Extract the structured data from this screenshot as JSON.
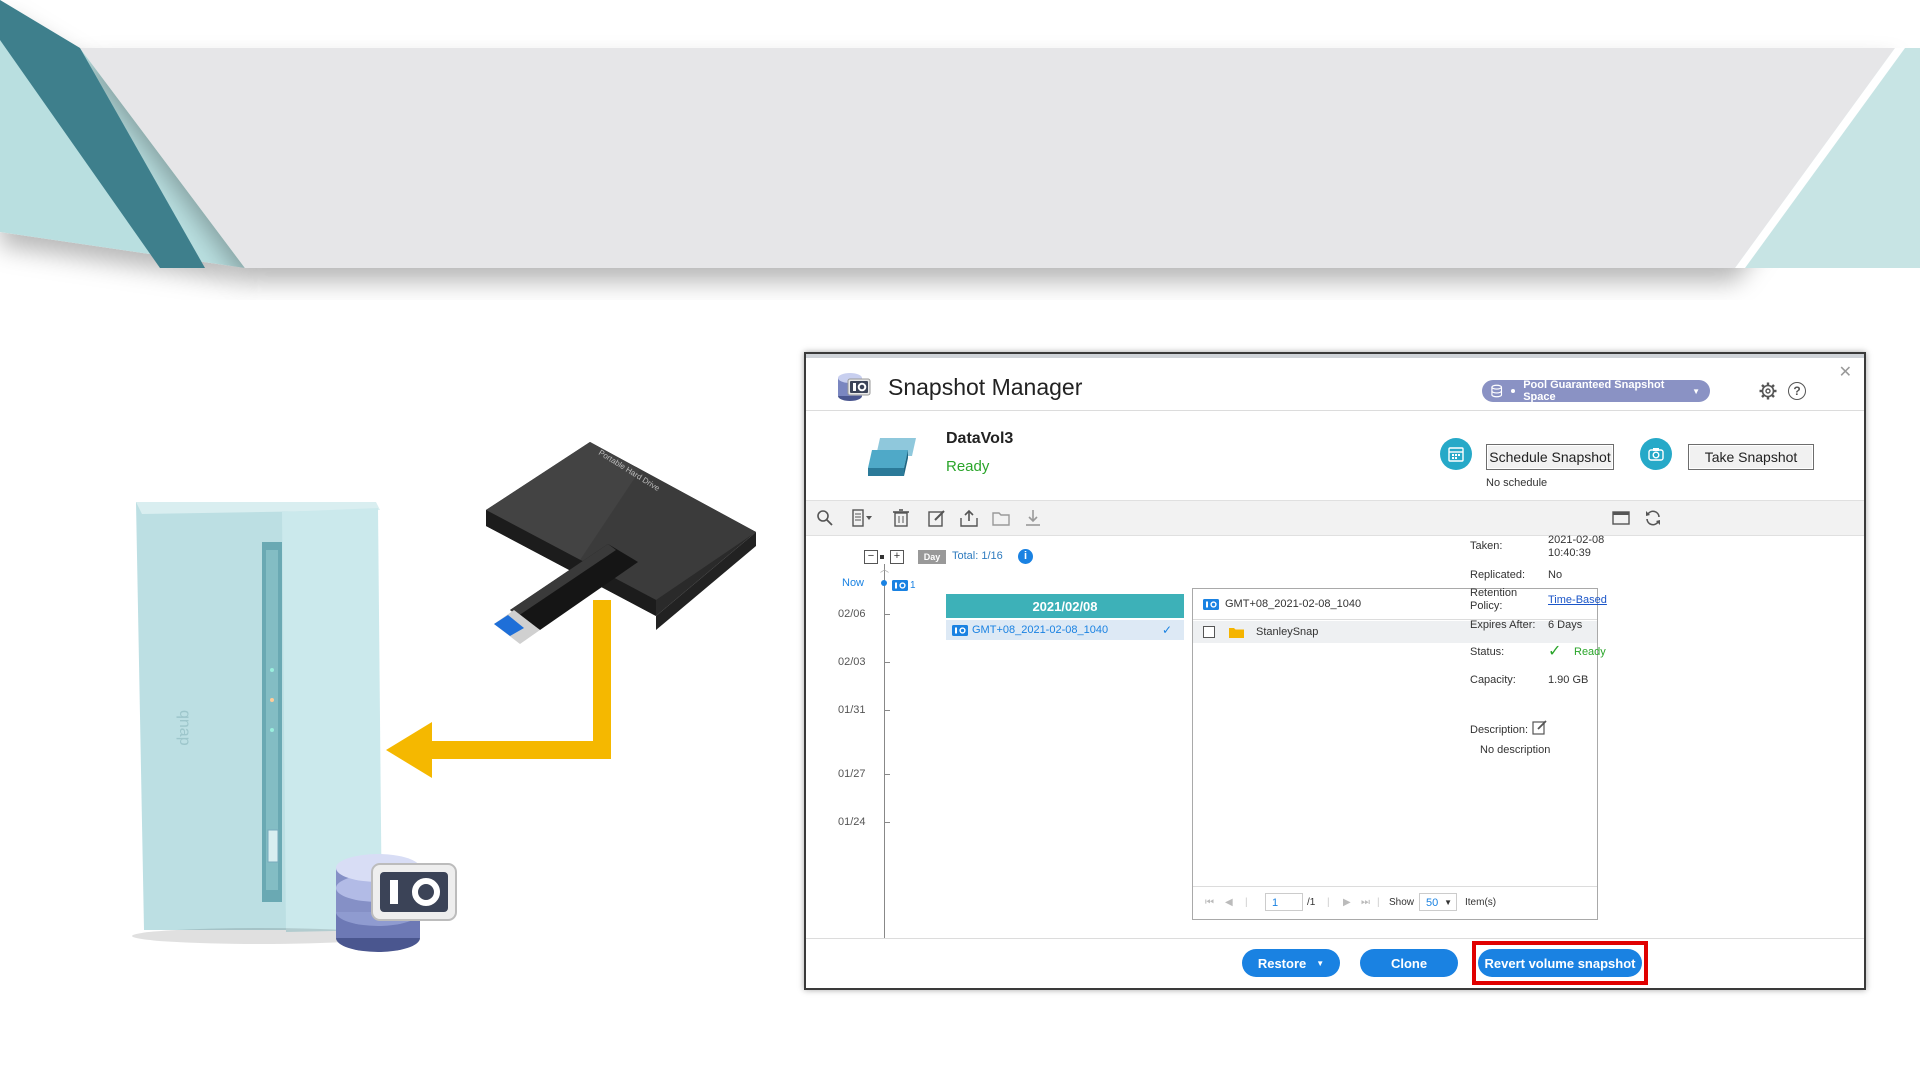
{
  "window": {
    "title": "Snapshot Manager",
    "close_icon": "close-icon",
    "pool_selector": "Pool Guaranteed Snapshot Space",
    "help_glyph": "?"
  },
  "volume": {
    "name": "DataVol3",
    "status": "Ready",
    "schedule_button": "Schedule Snapshot",
    "schedule_status": "No schedule",
    "take_button": "Take Snapshot"
  },
  "toolbar": {
    "icons": [
      "search-icon",
      "view-menu-icon",
      "delete-icon",
      "edit-icon",
      "export-icon",
      "open-folder-icon",
      "download-icon",
      "window-icon",
      "refresh-icon"
    ]
  },
  "timeline": {
    "collapse": "−",
    "expand": "+",
    "scale": "Day",
    "total": "Total: 1/16",
    "info": "i",
    "now_label": "Now",
    "now_count": "1",
    "dates": [
      "02/06",
      "02/03",
      "01/31",
      "01/27",
      "01/24"
    ]
  },
  "snapshot_list": {
    "date": "2021/02/08",
    "items": [
      "GMT+08_2021-02-08_1040"
    ]
  },
  "file_panel": {
    "header": "GMT+08_2021-02-08_1040",
    "rows": [
      "StanleySnap"
    ],
    "pager": {
      "page": "1",
      "of": "/1",
      "show_label": "Show",
      "per_page": "50",
      "items_label": "Item(s)"
    }
  },
  "properties": {
    "taken_label": "Taken:",
    "taken_date": "2021-02-08",
    "taken_time": "10:40:39",
    "replicated_label": "Replicated:",
    "replicated_value": "No",
    "retention_label_1": "Retention",
    "retention_label_2": "Policy:",
    "retention_value": "Time-Based",
    "expires_label": "Expires After:",
    "expires_value": "6 Days",
    "status_label": "Status:",
    "status_value": "Ready",
    "capacity_label": "Capacity:",
    "capacity_value": "1.90 GB",
    "description_label": "Description:",
    "description_value": "No description"
  },
  "footer": {
    "restore": "Restore",
    "clone": "Clone",
    "revert": "Revert volume snapshot"
  },
  "illustration": {
    "drive_text": "Portable Hard Drive",
    "brand_text": "qnap",
    "arrow_color": "#f5b800"
  },
  "colors": {
    "accent_blue": "#1a82e2",
    "teal": "#3db1b8",
    "ready_green": "#2aa52a",
    "highlight_red": "#e00000"
  }
}
